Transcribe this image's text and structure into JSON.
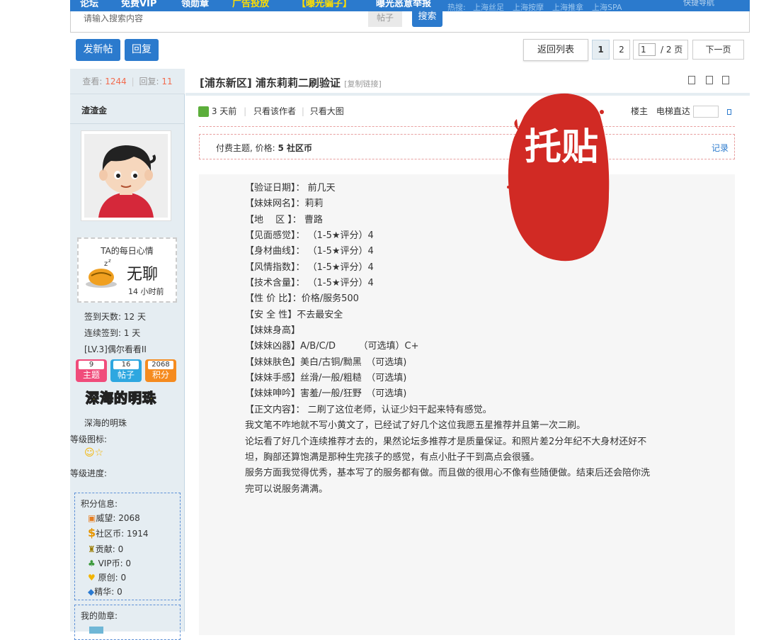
{
  "topnav": {
    "items": [
      "论坛",
      "免费VIP",
      "领勋章",
      "广告投放",
      "【曝光骗子】",
      "曝光恶意举报"
    ],
    "hot_label": "热搜:",
    "hot_items": [
      "上海丝足",
      "上海按摩",
      "上海推拿",
      "上海SPA"
    ],
    "right": "快捷导航"
  },
  "search": {
    "placeholder": "请输入搜索内容",
    "type": "帖子",
    "button": "搜索"
  },
  "actions": {
    "new_post": "发新帖",
    "reply": "回复"
  },
  "pager": {
    "back": "返回列表",
    "page1": "1",
    "page2": "2",
    "input": "1",
    "total": "/ 2 页",
    "next": "下一页"
  },
  "stats": {
    "views_label": "查看:",
    "views": "1244",
    "sep": "|",
    "replies_label": "回复:",
    "replies": "11"
  },
  "post": {
    "title": "[浦东新区] 浦东莉莉二刷验证",
    "copy_link": "[复制链接]",
    "time": "3 天前",
    "only_author": "只看该作者",
    "big_image": "只看大图",
    "floor": "楼主",
    "elevator": "电梯直达",
    "paid_notice": "付费主题, 价格: ",
    "paid_price": "5 社区币",
    "record": "记录",
    "stamp": "托贴"
  },
  "author": {
    "name": "渣渣金",
    "mood_title": "TA的每日心情",
    "mood": "无聊",
    "mood_time": "14 小时前",
    "sign_days": "签到天数: 12 天",
    "continuous": "连续签到: 1 天",
    "level": "[LV.3]偶尔看看II",
    "topics_num": "9",
    "topics_label": "主题",
    "posts_num": "16",
    "posts_label": "帖子",
    "points_num": "2068",
    "points_label": "积分",
    "badge": "深海的明珠",
    "badge_text": "深海的明珠",
    "level_icon_label": "等级图标:",
    "level_progress_label": "等级进度:",
    "points_info_title": "积分信息:",
    "wei": "威望: 2068",
    "coins": "社区币: 1914",
    "contrib": "贡献: 0",
    "vip": "VIP币: 0",
    "original": "原创: 0",
    "essence": "精华: 0",
    "medals": "我的勋章:"
  },
  "content": [
    "【验证日期】： 前几天",
    "【妹妹网名】：莉莉",
    "【地　  区 】： 曹路",
    "【见面感觉】： （1-5★评分）4",
    "【身材曲线】： （1-5★评分）4",
    "【风情指数】： （1-5★评分）4",
    "【技术含量】： （1-5★评分）4",
    "【性 价 比】：价格/服务500",
    "【安 全 性】不去最安全",
    "【妹妹身高】",
    "【妹妹凶器】A/B/C/D　　　（可选填）C+",
    "【妹妹肤色】美白/古铜/黝黑　（可选填)",
    "【妹妹手感】丝滑/一般/粗糙　（可选填)",
    "【妹妹呻吟】害羞/一般/狂野　（可选填)",
    "【正文内容】： 二刷了这位老师，认证少妇干起来特有感觉。",
    "我文笔不咋地就不写小黄文了，已经试了好几个这位我愿五星推荐并且第一次二刷。",
    "论坛看了好几个连续推荐才去的，果然论坛多推荐才是质量保证。和照片差2分年纪不大身材还好不",
    "坦，胸部还算饱满是那种生完孩子的感觉，有点小肚子干到高点会很骚。",
    "服务方面我觉得优秀，基本写了的服务都有做。而且做的很用心不像有些随便做。结束后还会陪你洗",
    "完可以说服务满满。"
  ],
  "colors": {
    "accent": "#2b7acd",
    "red": "#d4302f",
    "orange": "#ff6600",
    "sidebar_bg": "#e5edf2"
  }
}
